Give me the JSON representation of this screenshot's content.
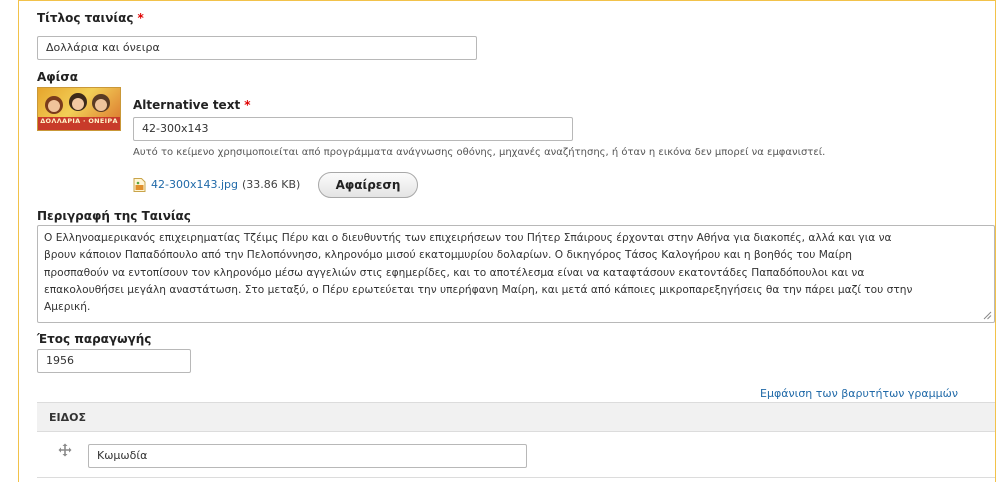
{
  "movie_title": {
    "label": "Τίτλος ταινίας",
    "required_mark": "*",
    "value": "Δολλάρια και όνειρα"
  },
  "poster": {
    "label": "Αφίσα",
    "image_icon": "poster-thumbnail",
    "poster_text": "ΔΟΛΛΑΡΙΑ · ΟΝΕΙΡΑ",
    "alt_text": {
      "label": "Alternative text",
      "required_mark": "*",
      "value": "42-300x143",
      "description": "Αυτό το κείμενο χρησιμοποιείται από προγράμματα ανάγνωσης οθόνης, μηχανές αναζήτησης, ή όταν η εικόνα δεν μπορεί να εμφανιστεί."
    },
    "file": {
      "icon": "image-file-icon",
      "name": "42-300x143.jpg",
      "size": "(33.86 KB)"
    },
    "remove_button": "Αφαίρεση"
  },
  "description": {
    "label": "Περιγραφή της Ταινίας",
    "lines": [
      "Ο Ελληνοαμερικανός επιχειρηματίας Τζέιμς Πέρυ και ο διευθυντής των επιχειρήσεων του Πήτερ Σπάιρους έρχονται στην Αθήνα για διακοπές, αλλά και για να",
      "βρουν κάποιον Παπαδόπουλο από την Πελοπόννησο, κληρονόμο μισού εκατομμυρίου δολαρίων. Ο δικηγόρος Τάσος Καλογήρου και η βοηθός του Μαίρη",
      "προσπαθούν να εντοπίσουν τον κληρονόμο μέσω αγγελιών στις εφημερίδες, και το αποτέλεσμα είναι να καταφτάσουν εκατοντάδες Παπαδόπουλοι και να",
      "επακολουθήσει μεγάλη αναστάτωση. Στο μεταξύ, ο Πέρυ ερωτεύεται την υπερήφανη Μαίρη, και μετά από κάποιες μικροπαρεξηγήσεις θα την πάρει μαζί του στην",
      "Αμερική."
    ]
  },
  "production_year": {
    "label": "Έτος παραγωγής",
    "value": "1956"
  },
  "show_weights_link": "Εμφάνιση των βαρυτήτων γραμμών",
  "genre_table": {
    "header": "ΕΙΔΟΣ",
    "rows": [
      {
        "drag_icon": "drag-handle-icon",
        "value": "Κωμωδία"
      }
    ]
  }
}
